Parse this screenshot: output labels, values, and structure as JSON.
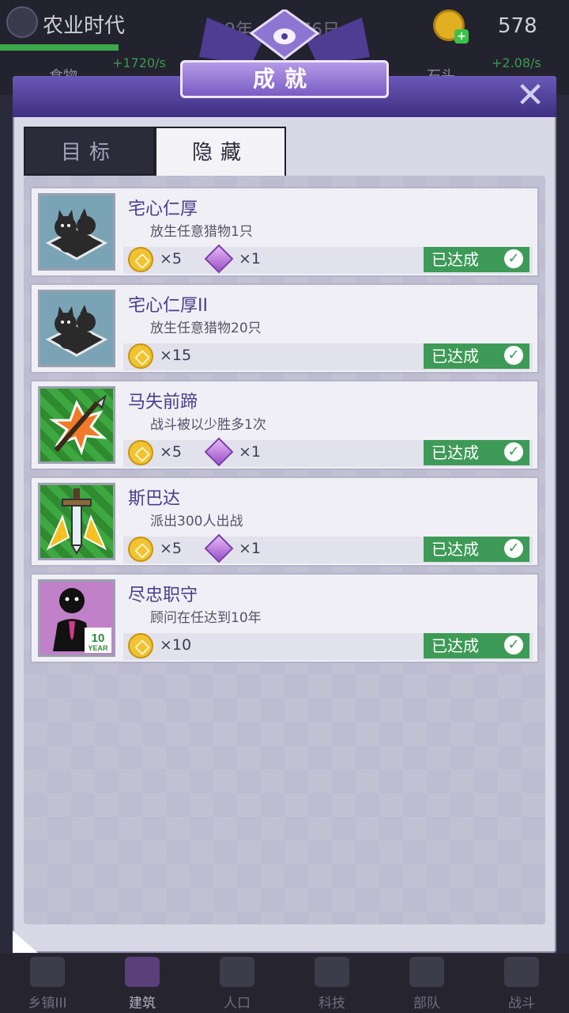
{
  "hud": {
    "era": "农业时代",
    "date_year": "19年",
    "date_day": "76日",
    "gold": "578",
    "food_label": "食物",
    "food_rate": "+1720/s",
    "stone_label": "石头",
    "stone_rate": "+2.08/s"
  },
  "modal": {
    "title": "成就",
    "close_symbol": "✕"
  },
  "tabs": [
    {
      "label": "目标",
      "active": false
    },
    {
      "label": "隐藏",
      "active": true
    }
  ],
  "achievements": [
    {
      "name": "宅心仁厚",
      "desc": "放生任意猎物1只",
      "coin": "×5",
      "gem": "×1",
      "status": "已达成",
      "icon": "animals-released-icon"
    },
    {
      "name": "宅心仁厚II",
      "desc": "放生任意猎物20只",
      "coin": "×15",
      "gem": "",
      "status": "已达成",
      "icon": "animals-released-icon"
    },
    {
      "name": "马失前蹄",
      "desc": "战斗被以少胜多1次",
      "coin": "×5",
      "gem": "×1",
      "status": "已达成",
      "icon": "broken-spear-icon"
    },
    {
      "name": "斯巴达",
      "desc": "派出300人出战",
      "coin": "×5",
      "gem": "×1",
      "status": "已达成",
      "icon": "sword-icon"
    },
    {
      "name": "尽忠职守",
      "desc": "顾问在任达到10年",
      "coin": "×10",
      "gem": "",
      "status": "已达成",
      "icon": "advisor-10-year-icon",
      "icon_text": "10",
      "icon_subtext": "YEAR"
    }
  ],
  "bottom_nav": [
    {
      "label": "乡镇III",
      "active": false
    },
    {
      "label": "建筑",
      "active": true
    },
    {
      "label": "人口",
      "active": false
    },
    {
      "label": "科技",
      "active": false
    },
    {
      "label": "部队",
      "active": false
    },
    {
      "label": "战斗",
      "active": false
    }
  ],
  "colors": {
    "accent_purple": "#6a58b8",
    "achieved_green": "#3e9a57",
    "coin_gold": "#f1c232",
    "gem_purple": "#9a52c9"
  }
}
